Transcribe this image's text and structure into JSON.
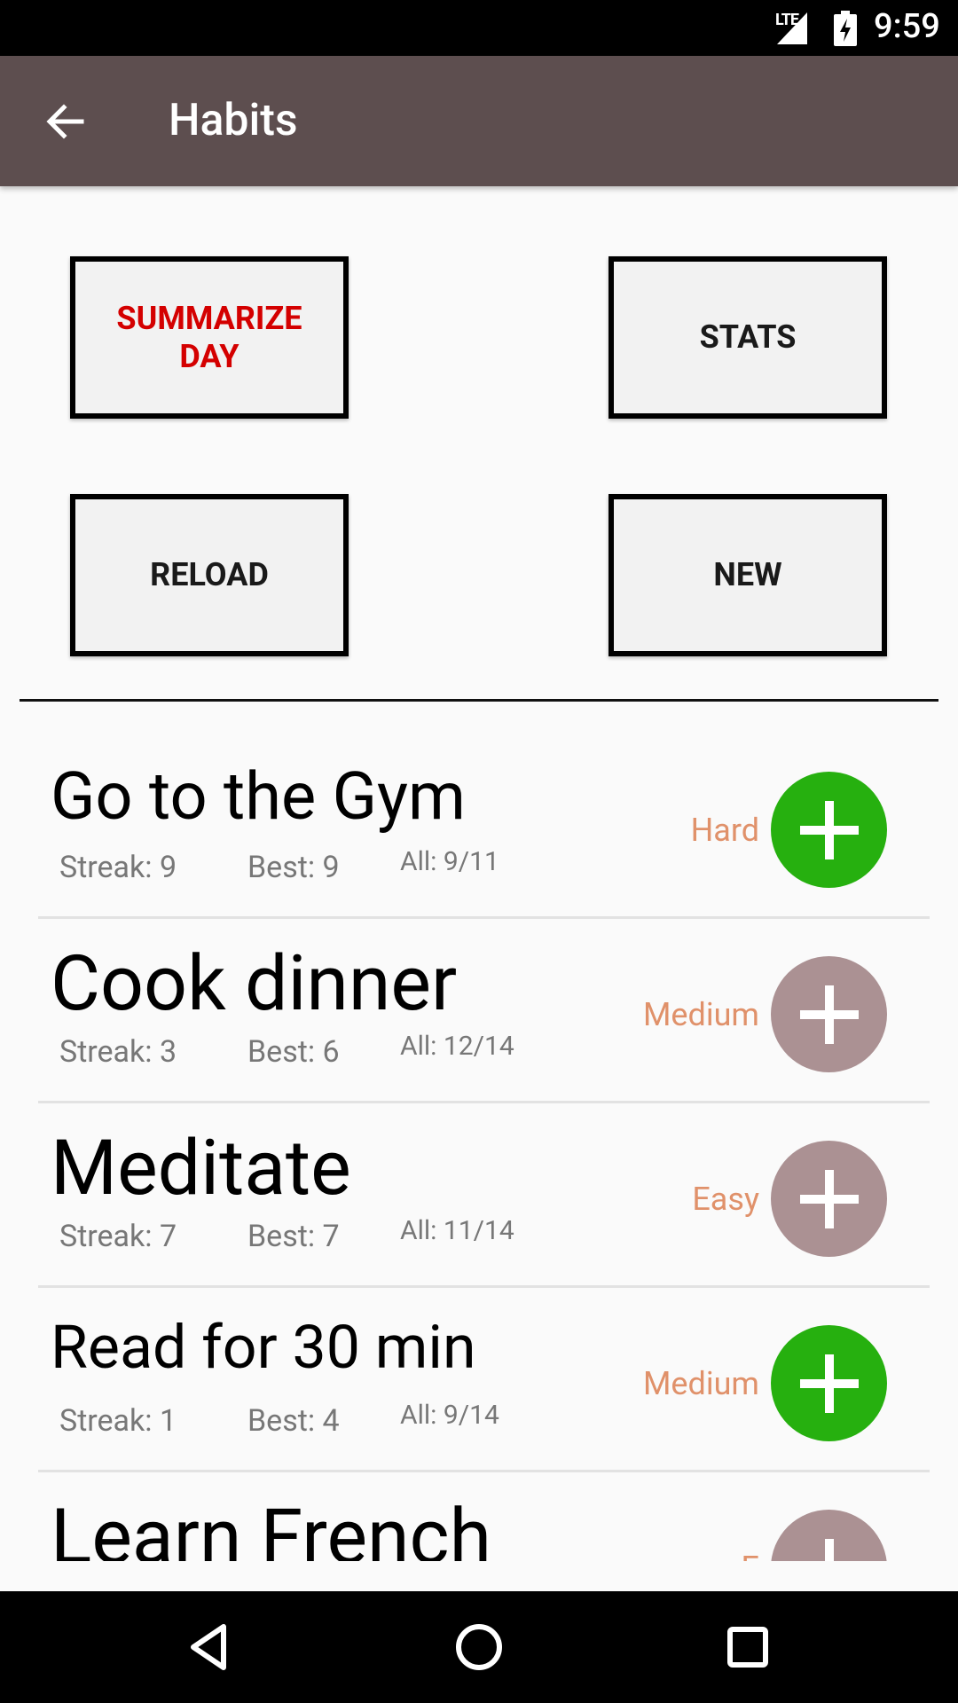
{
  "status_bar": {
    "network": "LTE",
    "time": "9:59"
  },
  "app_bar": {
    "title": "Habits"
  },
  "actions": {
    "summarize": "SUMMARIZE DAY",
    "stats": "STATS",
    "reload": "RELOAD",
    "new": "NEW"
  },
  "habits": [
    {
      "name": "Go to the Gym",
      "streak": "Streak: 9",
      "best": "Best: 9",
      "all": "All: 9/11",
      "difficulty": "Hard",
      "done": true
    },
    {
      "name": "Cook dinner",
      "streak": "Streak: 3",
      "best": "Best: 6",
      "all": "All: 12/14",
      "difficulty": "Medium",
      "done": false
    },
    {
      "name": "Meditate",
      "streak": "Streak: 7",
      "best": "Best: 7",
      "all": "All: 11/14",
      "difficulty": "Easy",
      "done": false
    },
    {
      "name": "Read for 30 min",
      "streak": "Streak: 1",
      "best": "Best: 4",
      "all": "All: 9/14",
      "difficulty": "Medium",
      "done": true
    },
    {
      "name": "Learn French",
      "streak": "",
      "best": "",
      "all": "",
      "difficulty": "E",
      "done": false
    }
  ],
  "colors": {
    "app_bar": "#5d4e4f",
    "summarize_text": "#d40000",
    "difficulty_text": "#e0916a",
    "add_done": "#26b00f",
    "add_todo": "#ab9193"
  }
}
